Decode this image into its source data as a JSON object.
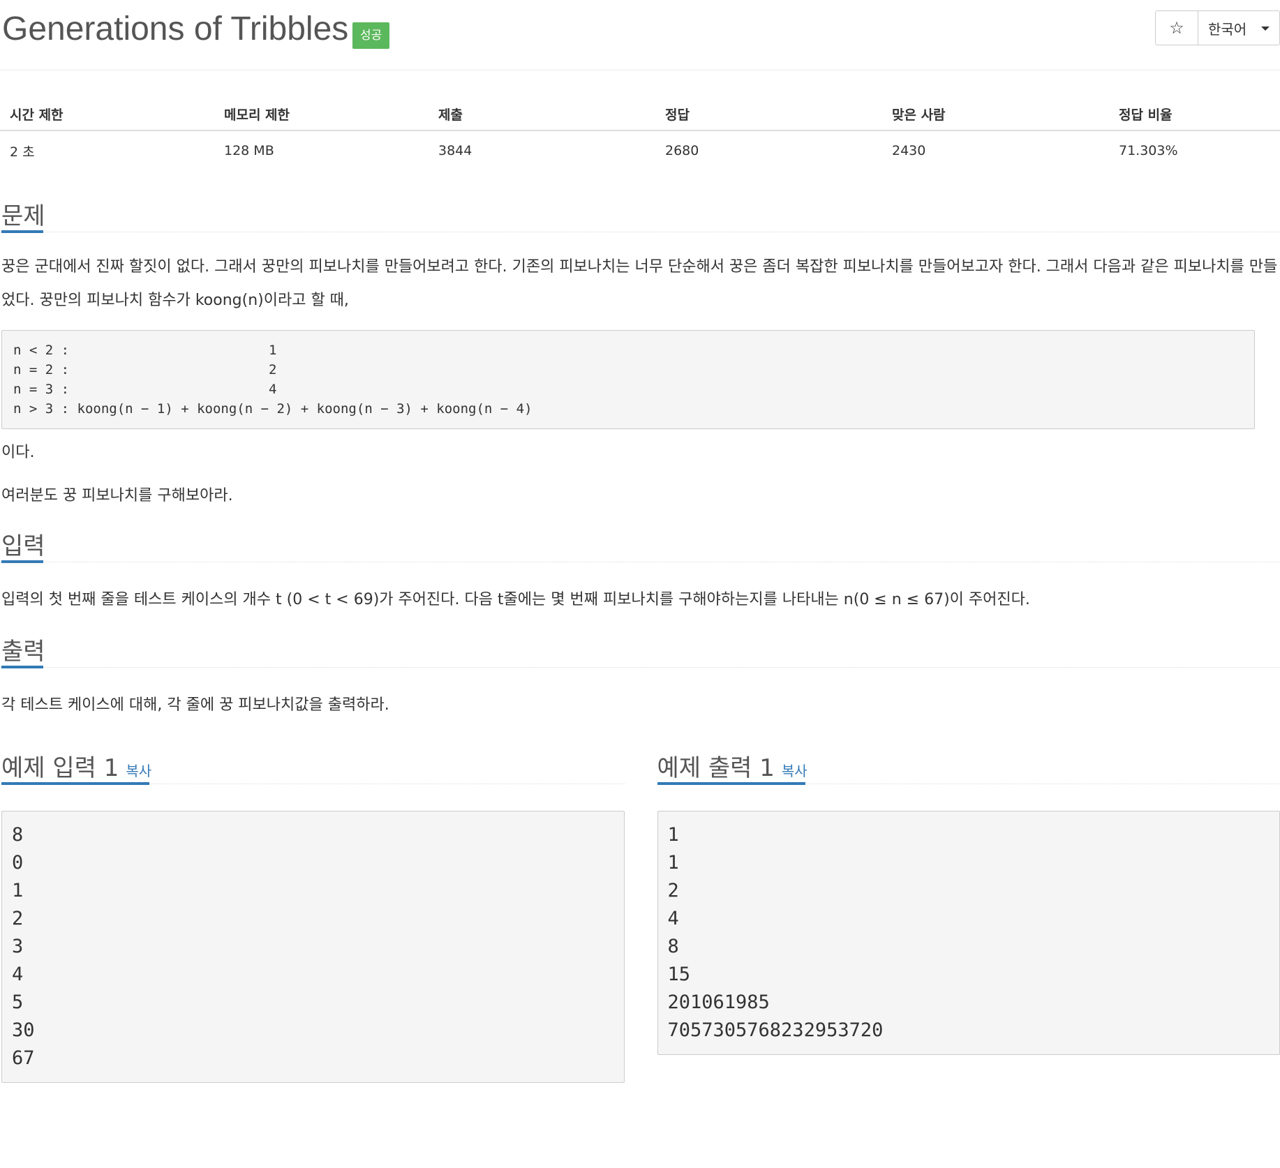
{
  "problem": {
    "title": "Generations of Tribbles",
    "status_badge": "성공"
  },
  "toolbar": {
    "star_label": "☆",
    "language": "한국어"
  },
  "info": {
    "headers": [
      "시간 제한",
      "메모리 제한",
      "제출",
      "정답",
      "맞은 사람",
      "정답 비율"
    ],
    "values": [
      "2 초",
      "128 MB",
      "3844",
      "2680",
      "2430",
      "71.303%"
    ]
  },
  "sections": {
    "problem": {
      "title": "문제",
      "paragraph1": "꿍은 군대에서 진짜 할짓이 없다. 그래서 꿍만의 피보나치를 만들어보려고 한다. 기존의 피보나치는 너무 단순해서 꿍은 좀더 복잡한 피보나치를 만들어보고자 한다. 그래서 다음과 같은 피보나치를 만들었다. 꿍만의 피보나치 함수가 koong(n)이라고 할 때,",
      "code": "n < 2 :                         1\nn = 2 :                         2\nn = 3 :                         4\nn > 3 : koong(n − 1) + koong(n − 2) + koong(n − 3) + koong(n − 4)",
      "paragraph2": "이다.",
      "paragraph3": "여러분도 꿍 피보나치를 구해보아라."
    },
    "input": {
      "title": "입력",
      "paragraph": "입력의 첫 번째 줄을 테스트 케이스의 개수 t (0 < t < 69)가 주어진다. 다음 t줄에는 몇 번째 피보나치를 구해야하는지를 나타내는 n(0 ≤ n ≤ 67)이 주어진다."
    },
    "output": {
      "title": "출력",
      "paragraph": "각 테스트 케이스에 대해, 각 줄에 꿍 피보나치값을 출력하라."
    }
  },
  "samples": {
    "input": {
      "title": "예제 입력 1",
      "copy_label": "복사",
      "content": "8\n0\n1\n2\n3\n4\n5\n30\n67"
    },
    "output": {
      "title": "예제 출력 1",
      "copy_label": "복사",
      "content": "1\n1\n2\n4\n8\n15\n201061985\n7057305768232953720"
    }
  }
}
